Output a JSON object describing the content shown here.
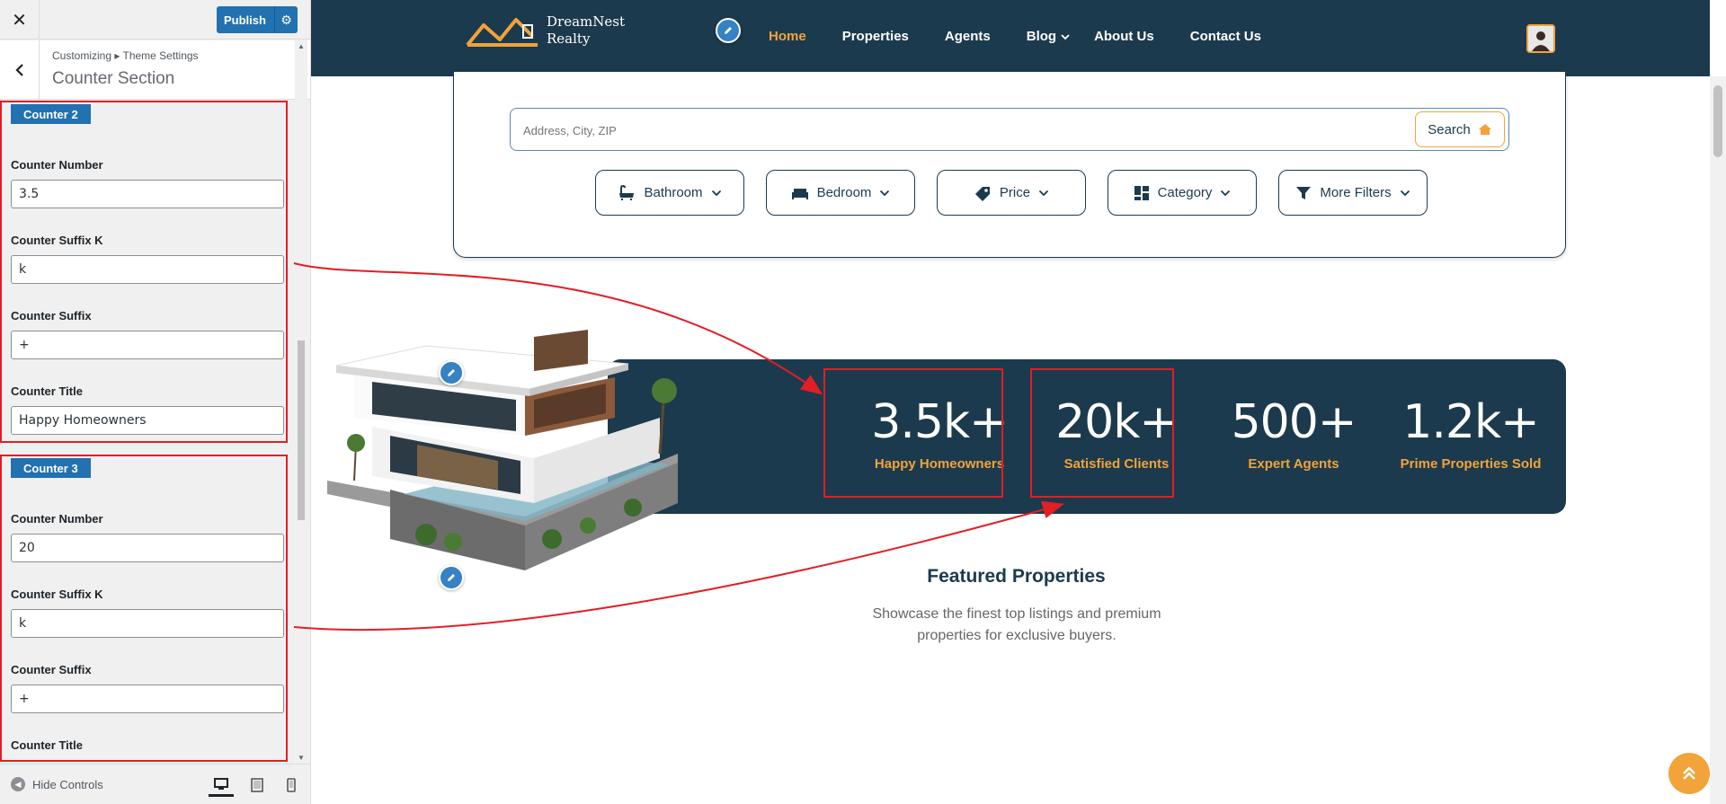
{
  "customizer": {
    "close_icon": "close-icon",
    "publish_label": "Publish",
    "breadcrumb": "Customizing ▸ Theme Settings",
    "section_title": "Counter Section",
    "hide_controls_label": "Hide Controls",
    "device_modes": [
      "desktop-icon",
      "tablet-icon",
      "mobile-icon"
    ],
    "counters": [
      {
        "badge": "Counter 2",
        "number_label": "Counter Number",
        "number_value": "3.5",
        "suffix_k_label": "Counter Suffix K",
        "suffix_k_value": "k",
        "suffix_label": "Counter Suffix",
        "suffix_value": "+",
        "title_label": "Counter Title",
        "title_value": "Happy Homeowners"
      },
      {
        "badge": "Counter 3",
        "number_label": "Counter Number",
        "number_value": "20",
        "suffix_k_label": "Counter Suffix K",
        "suffix_k_value": "k",
        "suffix_label": "Counter Suffix",
        "suffix_value": "+",
        "title_label": "Counter Title"
      }
    ]
  },
  "site": {
    "logo_line1": "DreamNest",
    "logo_line2": "Realty",
    "nav": [
      "Home",
      "Properties",
      "Agents",
      "Blog",
      "About Us",
      "Contact Us"
    ],
    "active_nav": "Home",
    "search_placeholder": "Address, City, ZIP",
    "search_button": "Search",
    "filters": [
      "Bathroom",
      "Bedroom",
      "Price",
      "Category",
      "More Filters"
    ],
    "stats": [
      {
        "value": "3.5k+",
        "label": "Happy Homeowners"
      },
      {
        "value": "20k+",
        "label": "Satisfied Clients"
      },
      {
        "value": "500+",
        "label": "Expert Agents"
      },
      {
        "value": "1.2k+",
        "label": "Prime Properties Sold"
      }
    ],
    "featured_title": "Featured Properties",
    "featured_subtitle": "Showcase the finest top listings and premium properties for exclusive buyers."
  },
  "colors": {
    "navy": "#1c3a4d",
    "accent": "#f2a33a",
    "wp_blue": "#2271b1",
    "highlight_red": "#e31e24"
  }
}
